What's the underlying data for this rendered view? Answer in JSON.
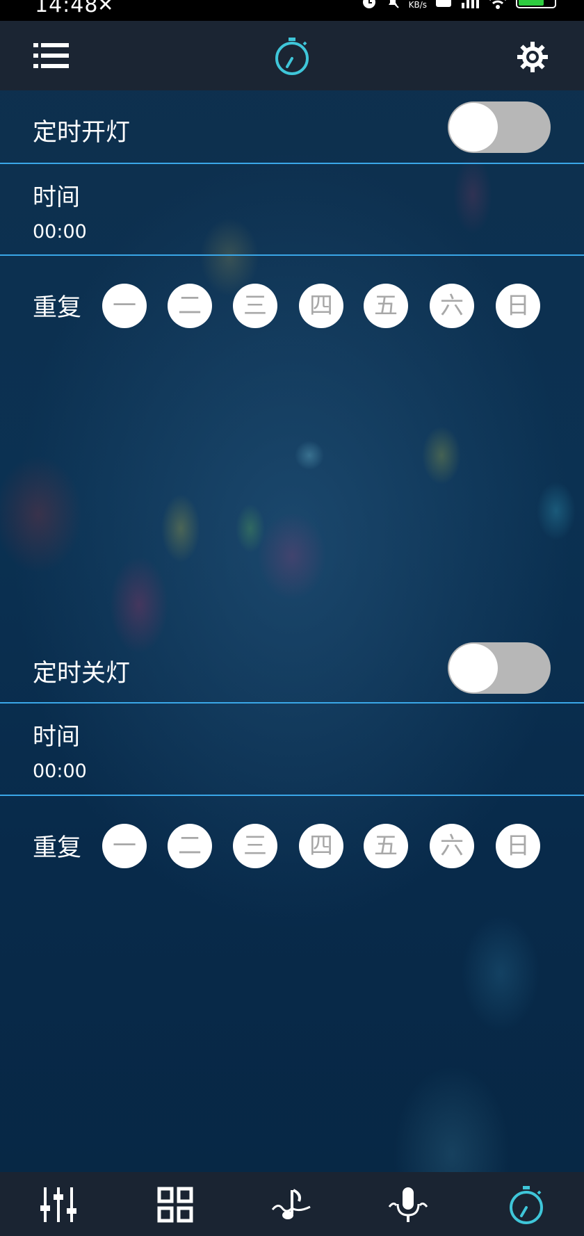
{
  "status_bar": {
    "time": "14:48",
    "network_speed_unit": "KB/s",
    "battery_color": "#2ecc40"
  },
  "header": {
    "left_icon": "menu-list-icon",
    "center_icon": "stopwatch-icon",
    "right_icon": "gear-icon",
    "accent_color": "#3fc6d9"
  },
  "timer_on": {
    "label": "定时开灯",
    "enabled": false,
    "time_label": "时间",
    "time_value": "00:00",
    "repeat_label": "重复",
    "days": [
      "一",
      "二",
      "三",
      "四",
      "五",
      "六",
      "日"
    ]
  },
  "timer_off": {
    "label": "定时关灯",
    "enabled": false,
    "time_label": "时间",
    "time_value": "00:00",
    "repeat_label": "重复",
    "days": [
      "一",
      "二",
      "三",
      "四",
      "五",
      "六",
      "日"
    ]
  },
  "bottom_nav": {
    "items": [
      {
        "icon": "equalizer-sliders-icon",
        "active": false
      },
      {
        "icon": "grid-icon",
        "active": false
      },
      {
        "icon": "music-note-wave-icon",
        "active": false
      },
      {
        "icon": "microphone-icon",
        "active": false
      },
      {
        "icon": "stopwatch-icon",
        "active": true
      }
    ],
    "active_color": "#3fc6d9",
    "inactive_color": "#ffffff"
  }
}
